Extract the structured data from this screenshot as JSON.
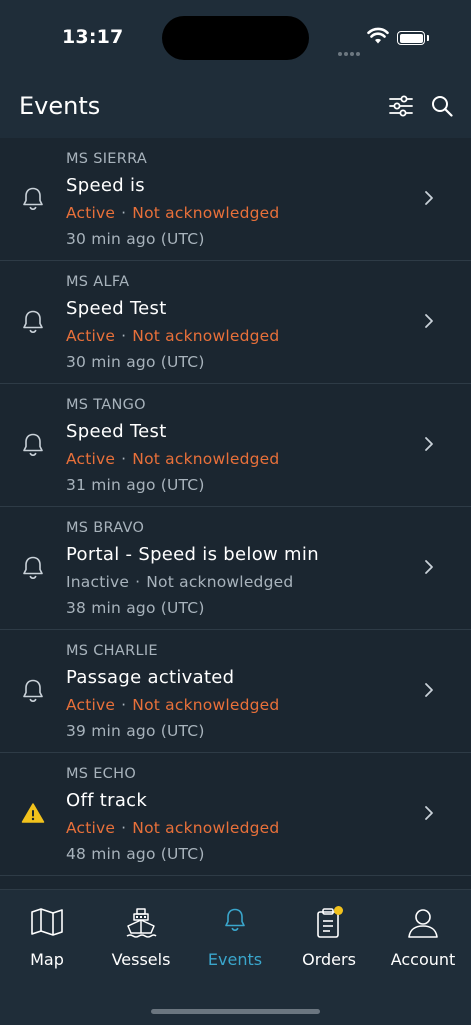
{
  "status_bar": {
    "time": "13:17"
  },
  "header": {
    "title": "Events"
  },
  "events": [
    {
      "vessel": "MS SIERRA",
      "title": "Speed is",
      "state": "Active",
      "ack": "Not acknowledged",
      "time": "30 min ago (UTC)",
      "icon": "bell-icon",
      "active": true
    },
    {
      "vessel": "MS ALFA",
      "title": "Speed Test",
      "state": "Active",
      "ack": "Not acknowledged",
      "time": "30 min ago (UTC)",
      "icon": "bell-icon",
      "active": true
    },
    {
      "vessel": "MS TANGO",
      "title": "Speed Test",
      "state": "Active",
      "ack": "Not acknowledged",
      "time": "31 min ago (UTC)",
      "icon": "bell-icon",
      "active": true
    },
    {
      "vessel": "MS BRAVO",
      "title": "Portal - Speed is below min",
      "state": "Inactive",
      "ack": "Not acknowledged",
      "time": "38 min ago (UTC)",
      "icon": "bell-icon",
      "active": false
    },
    {
      "vessel": "MS CHARLIE",
      "title": "Passage activated",
      "state": "Active",
      "ack": "Not acknowledged",
      "time": "39 min ago (UTC)",
      "icon": "bell-icon",
      "active": true
    },
    {
      "vessel": "MS ECHO",
      "title": "Off track",
      "state": "Active",
      "ack": "Not acknowledged",
      "time": "48 min ago (UTC)",
      "icon": "warning-icon",
      "active": true
    }
  ],
  "tabs": [
    {
      "label": "Map",
      "icon": "map-icon"
    },
    {
      "label": "Vessels",
      "icon": "ship-icon"
    },
    {
      "label": "Events",
      "icon": "bell-icon",
      "active": true
    },
    {
      "label": "Orders",
      "icon": "clipboard-icon",
      "badge": true
    },
    {
      "label": "Account",
      "icon": "person-icon"
    }
  ],
  "colors": {
    "active": "#e8703a",
    "muted": "#a8b3bc",
    "accent": "#3aa6cc",
    "badge": "#f2c21c",
    "warning": "#f2c21c"
  }
}
